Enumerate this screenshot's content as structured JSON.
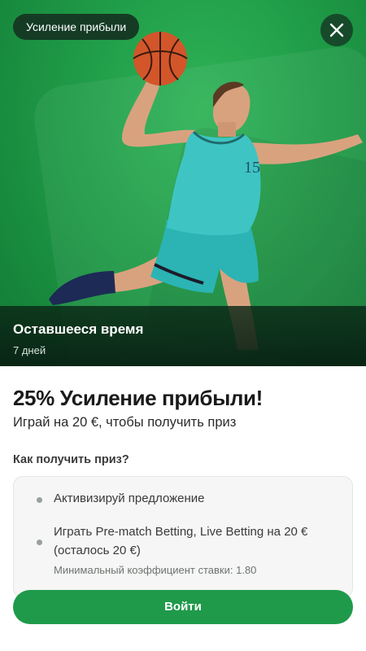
{
  "promo": {
    "badge": "Усиление прибыли",
    "time_title": "Оставшееся время",
    "time_value": "7 дней",
    "headline": "25% Усиление прибыли!",
    "subline": "Играй на 20 €, чтобы получить приз",
    "howto_title": "Как получить приз?",
    "steps": [
      {
        "text": "Активизируй предложение"
      },
      {
        "text": "Играть Pre-match Betting, Live Betting на 20 €",
        "text2": "(осталось 20 €)",
        "note": "Минимальный коэффициент ставки: 1.80"
      }
    ],
    "login_label": "Войти",
    "jersey_number": "15"
  },
  "colors": {
    "hero_green": "#1f9b47",
    "button_green": "#1f9a4a",
    "badge_bg": "#153b24",
    "jersey": "#3fc4c4"
  },
  "icons": {
    "close": "close-icon",
    "ball": "basketball-icon"
  }
}
